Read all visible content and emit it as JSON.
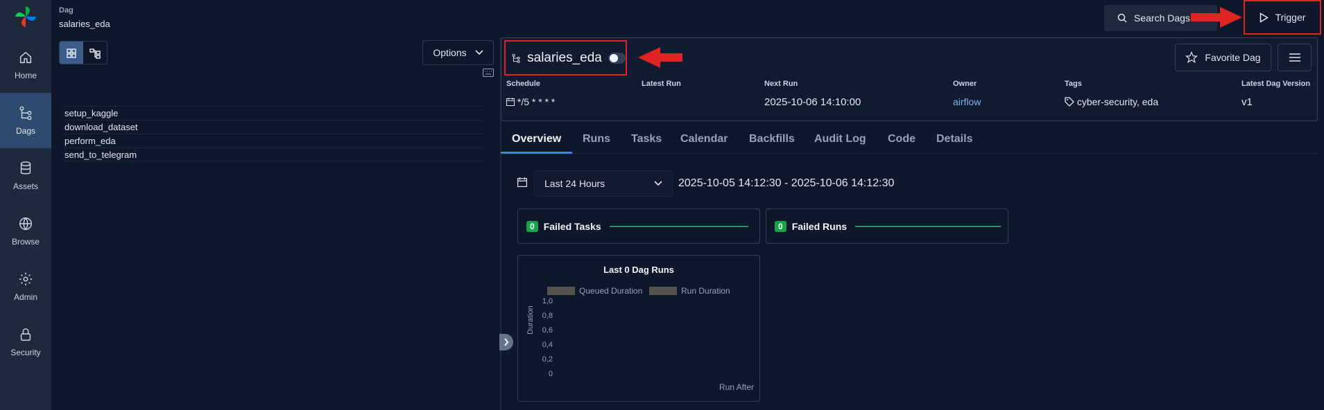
{
  "nav": {
    "items": [
      {
        "label": "Home",
        "icon": "home-icon"
      },
      {
        "label": "Dags",
        "icon": "dags-icon",
        "active": true
      },
      {
        "label": "Assets",
        "icon": "database-icon"
      },
      {
        "label": "Browse",
        "icon": "globe-icon"
      },
      {
        "label": "Admin",
        "icon": "gear-icon"
      },
      {
        "label": "Security",
        "icon": "lock-icon"
      }
    ]
  },
  "header": {
    "label": "Dag",
    "value": "salaries_eda"
  },
  "left_panel": {
    "options_label": "Options",
    "tasks": [
      "setup_kaggle",
      "download_dataset",
      "perform_eda",
      "send_to_telegram"
    ]
  },
  "top": {
    "search_label": "Search Dags",
    "trigger_label": "Trigger"
  },
  "dag": {
    "name": "salaries_eda",
    "favorite_label": "Favorite Dag",
    "meta": {
      "schedule_label": "Schedule",
      "schedule_value": "*/5 * * * *",
      "latest_run_label": "Latest Run",
      "next_run_label": "Next Run",
      "next_run_value": "2025-10-06 14:10:00",
      "owner_label": "Owner",
      "owner_value": "airflow",
      "tags_label": "Tags",
      "tags_value": "cyber-security, eda",
      "version_label": "Latest Dag Version",
      "version_value": "v1"
    }
  },
  "tabs": [
    "Overview",
    "Runs",
    "Tasks",
    "Calendar",
    "Backfills",
    "Audit Log",
    "Code",
    "Details"
  ],
  "filter": {
    "range_label": "Last 24 Hours",
    "range_text": "2025-10-05 14:12:30 - 2025-10-06 14:12:30"
  },
  "stats": {
    "failed_tasks": {
      "count": "0",
      "label": "Failed Tasks"
    },
    "failed_runs": {
      "count": "0",
      "label": "Failed Runs"
    }
  },
  "chart": {
    "title": "Last 0 Dag Runs",
    "legend_queued": "Queued Duration",
    "legend_run": "Run Duration",
    "ylabel": "Duration",
    "xlabel": "Run After",
    "yticks": [
      "1,0",
      "0,8",
      "0,6",
      "0,4",
      "0,2",
      "0"
    ]
  },
  "colors": {
    "accent": "#3b82f6",
    "annotation_red": "#e02424",
    "success": "#16a34a",
    "link": "#7db4f7"
  }
}
